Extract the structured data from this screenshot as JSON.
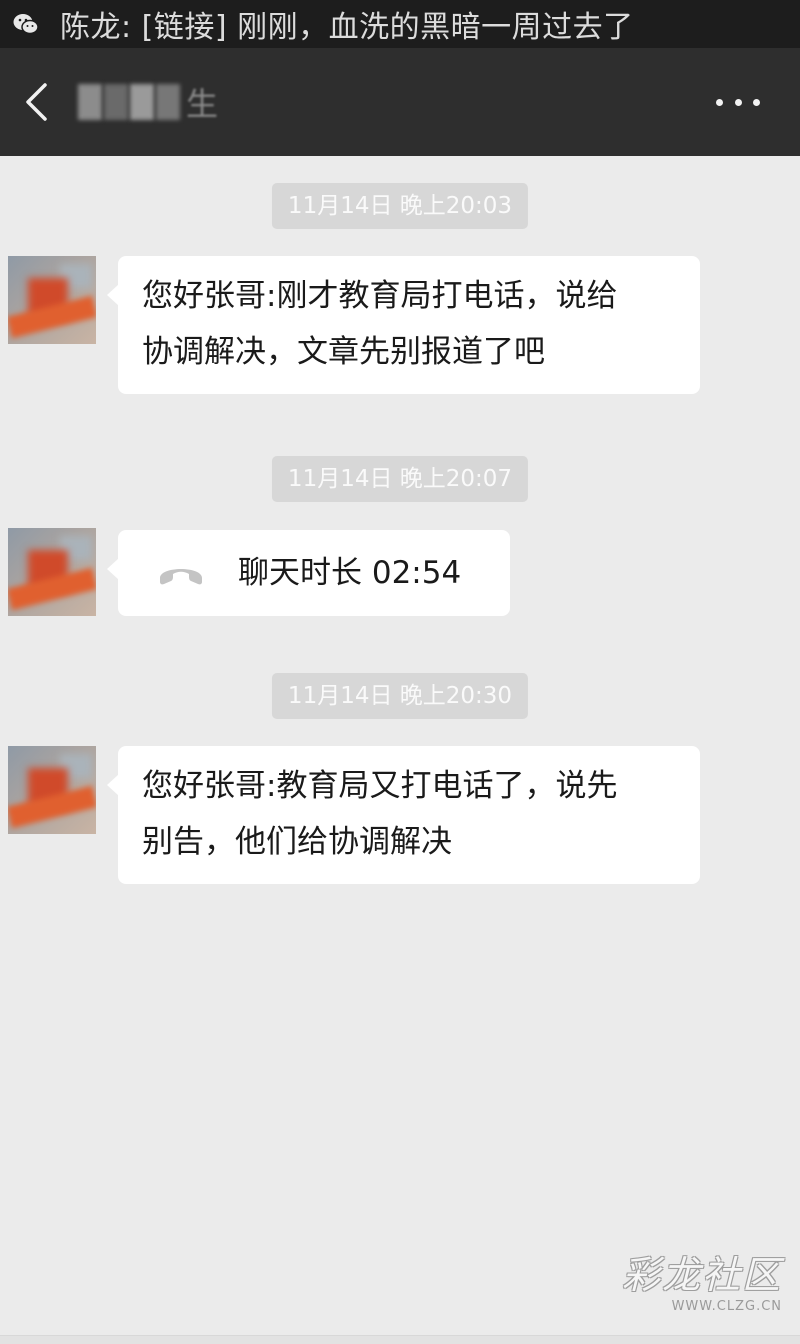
{
  "notification": {
    "icon": "wechat-icon",
    "text": "陈龙: [链接] 刚刚，血洗的黑暗一周过去了"
  },
  "header": {
    "back_icon": "back-arrow-icon",
    "contact_name_visible_tail": "生",
    "more_icon": "more-dots-icon"
  },
  "messages": [
    {
      "timestamp": "11月14日 晚上20:03",
      "type": "text",
      "lines": [
        "您好张哥:刚才教育局打电话，说给",
        "协调解决，文章先别报道了吧"
      ]
    },
    {
      "timestamp": "11月14日 晚上20:07",
      "type": "call",
      "icon": "phone-hangup-icon",
      "text": "聊天时长 02:54"
    },
    {
      "timestamp": "11月14日 晚上20:30",
      "type": "text",
      "lines": [
        "您好张哥:教育局又打电话了，说先",
        "别告，他们给协调解决"
      ]
    }
  ],
  "watermark": {
    "main": "彩龙社区",
    "url": "WWW.CLZG.CN"
  },
  "colors": {
    "notification_bg": "#1d1d1d",
    "titlebar_bg": "#2e2e2e",
    "chat_bg": "#ebebeb",
    "bubble_bg": "#ffffff",
    "timestamp_bg": "#d7d7d7"
  }
}
